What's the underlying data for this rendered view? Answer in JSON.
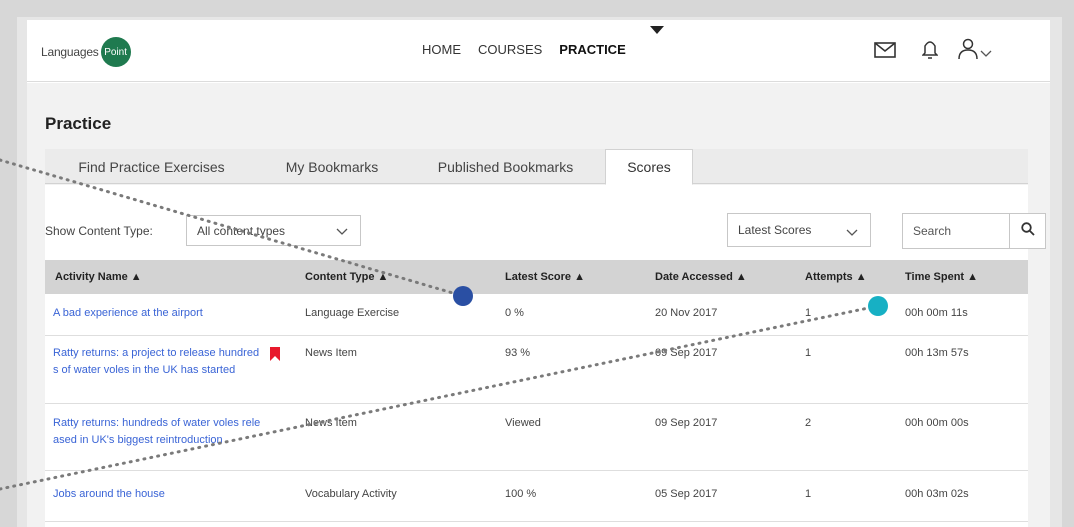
{
  "brand": {
    "name": "Languages",
    "badge": "Point"
  },
  "nav": {
    "items": [
      "HOME",
      "COURSES",
      "PRACTICE"
    ],
    "active": "PRACTICE"
  },
  "header_icons": [
    "mail-icon",
    "bell-icon",
    "user-icon",
    "chevron-down-icon"
  ],
  "page": {
    "title": "Practice"
  },
  "tabs": [
    "Find Practice Exercises",
    "My Bookmarks",
    "Published Bookmarks",
    "Scores"
  ],
  "active_tab": "Scores",
  "filters": {
    "content_type_label": "Show Content Type:",
    "content_type_value": "All content types",
    "sort_value": "Latest Scores",
    "search_placeholder": "Search"
  },
  "table": {
    "columns": [
      "Activity Name ▲",
      "Content Type ▲",
      "Latest Score ▲",
      "Date Accessed ▲",
      "Attempts ▲",
      "Time Spent ▲"
    ],
    "rows": [
      {
        "name": "A bad experience at the airport",
        "type": "Language Exercise",
        "score": "0 %",
        "date": "20 Nov 2017",
        "attempts": "1",
        "time": "00h 00m 11s",
        "bookmarked": false
      },
      {
        "name": "Ratty returns: a project to release hundreds of water voles in the UK has started",
        "type": "News Item",
        "score": "93 %",
        "date": "09 Sep 2017",
        "attempts": "1",
        "time": "00h 13m 57s",
        "bookmarked": true
      },
      {
        "name": "Ratty returns: hundreds of water voles released in UK's biggest reintroduction",
        "type": "News Item",
        "score": "Viewed",
        "date": "09 Sep 2017",
        "attempts": "2",
        "time": "00h 00m 00s",
        "bookmarked": false
      },
      {
        "name": "Jobs around the house",
        "type": "Vocabulary Activity",
        "score": "100 %",
        "date": "05 Sep 2017",
        "attempts": "1",
        "time": "00h 03m 02s",
        "bookmarked": false
      }
    ]
  },
  "colors": {
    "link": "#3a64d6",
    "bookmark": "#e8192c",
    "marker_blue": "#2a4fa3",
    "marker_teal": "#17b0c4",
    "logo_green": "#1f7a4f"
  }
}
